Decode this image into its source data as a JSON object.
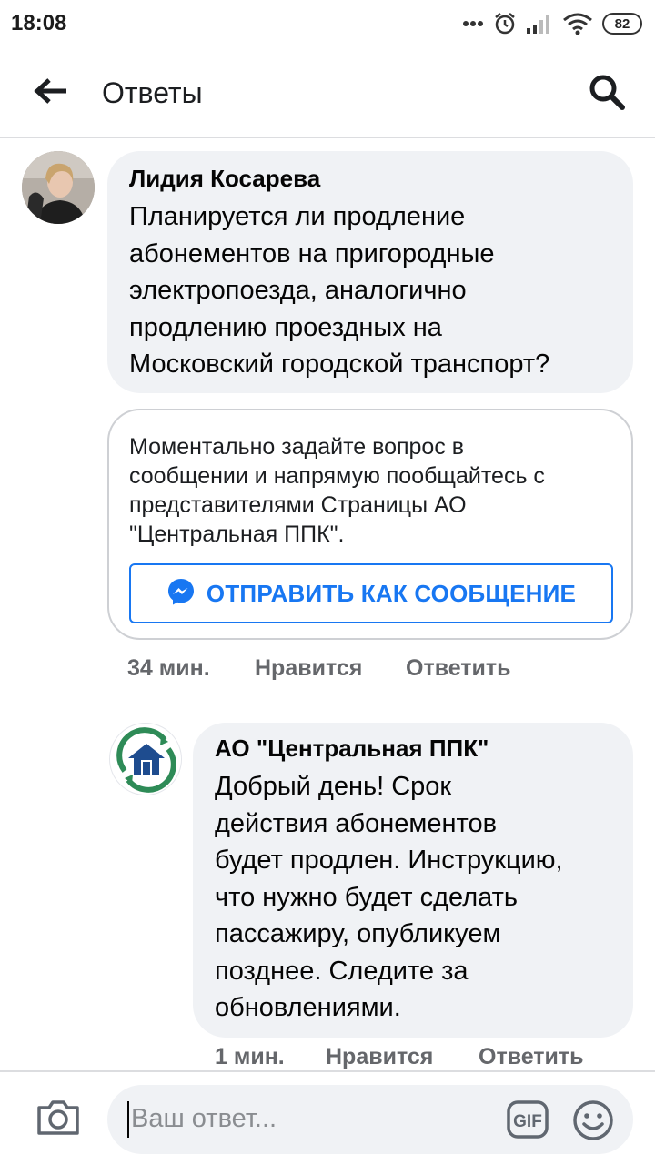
{
  "status_bar": {
    "time": "18:08",
    "battery": "82",
    "icons": [
      "more-dots-icon",
      "alarm-icon",
      "signal-icon",
      "wifi-icon",
      "battery-icon"
    ]
  },
  "header": {
    "title": "Ответы",
    "back_icon": "arrow-left-icon",
    "search_icon": "search-icon"
  },
  "comment": {
    "author": "Лидия Косарева",
    "lines": [
      "Планируется ли продление",
      "абонементов на пригородные",
      "электропоезда, аналогично",
      "продлению проездных на",
      "Московский городской транспорт?"
    ],
    "time": "34 мин.",
    "like": "Нравится",
    "reply": "Ответить"
  },
  "message_card": {
    "lines": [
      "Моментально задайте вопрос в",
      "сообщении и напрямую пообщайтесь с",
      "представителями Страницы АО",
      "\"Центральная ППК\"."
    ],
    "button": "ОТПРАВИТЬ КАК СООБЩЕНИЕ",
    "button_icon": "messenger-icon",
    "accent": "#1877f2"
  },
  "reply": {
    "author": "АО \"Центральная ППК\"",
    "lines": [
      "Добрый день! Срок",
      "действия абонементов",
      "будет продлен. Инструкцию,",
      "что нужно будет сделать",
      "пассажиру, опубликуем",
      "позднее. Следите за",
      "обновлениями."
    ],
    "time": "1 мин.",
    "like": "Нравится",
    "reply": "Ответить"
  },
  "composer": {
    "placeholder": "Ваш ответ...",
    "gif_label": "GIF",
    "icons": [
      "camera-icon",
      "gif-icon",
      "emoji-icon"
    ]
  }
}
